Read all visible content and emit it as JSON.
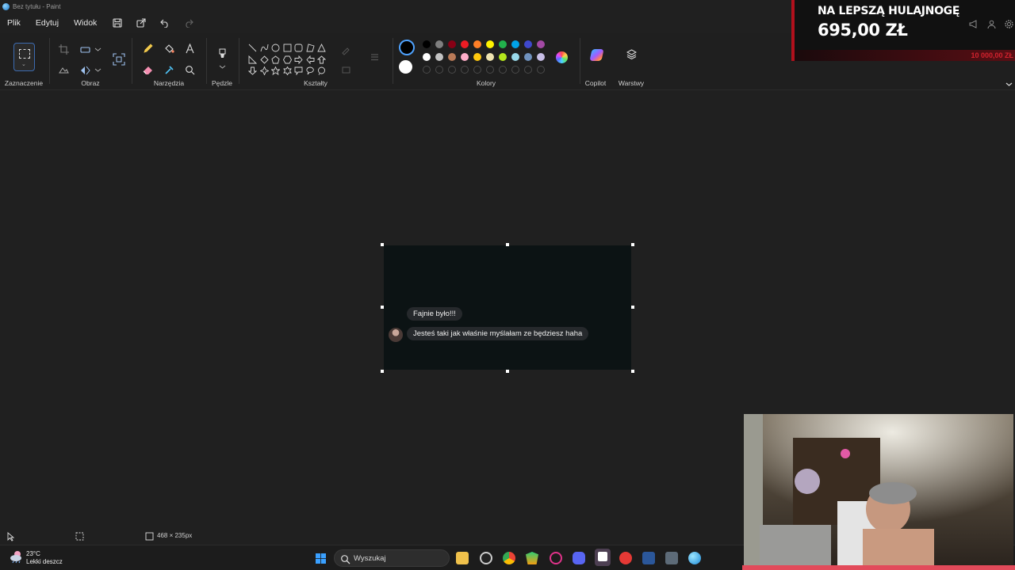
{
  "window": {
    "title": "Bez tytułu - Paint"
  },
  "menu": {
    "file": "Plik",
    "edit": "Edytuj",
    "view": "Widok"
  },
  "ribbon": {
    "groups": {
      "selection": "Zaznaczenie",
      "image": "Obraz",
      "tools": "Narzędzia",
      "brushes": "Pędzle",
      "shapes": "Kształty",
      "colors": "Kolory",
      "copilot": "Copilot",
      "layers": "Warstwy"
    },
    "colors": {
      "current_primary": "#000000",
      "current_secondary": "#ffffff",
      "row1": [
        "#000000",
        "#7f7f7f",
        "#880015",
        "#ed1c24",
        "#ff7f27",
        "#fff200",
        "#22b14c",
        "#00a2e8",
        "#3f48cc",
        "#a349a4"
      ],
      "row2": [
        "#ffffff",
        "#c3c3c3",
        "#b97a57",
        "#ffaec9",
        "#ffc90e",
        "#efe4b0",
        "#b5e61d",
        "#99d9ea",
        "#7092be",
        "#c8bfe7"
      ]
    }
  },
  "canvas": {
    "messages": [
      {
        "text": "Fajnie było!!!"
      },
      {
        "text": "Jesteś taki jak właśnie myślałam ze będziesz haha"
      }
    ]
  },
  "status": {
    "image_size": "468 × 235px"
  },
  "taskbar": {
    "weather_temp": "23°C",
    "weather_desc": "Lekki deszcz",
    "search_placeholder": "Wyszukaj"
  },
  "overlay": {
    "donation_line1": "NA LEPSZĄ HULAJNOGĘ",
    "donation_line2": "695,00 ZŁ",
    "goal": "10 000,00 ZŁ"
  }
}
